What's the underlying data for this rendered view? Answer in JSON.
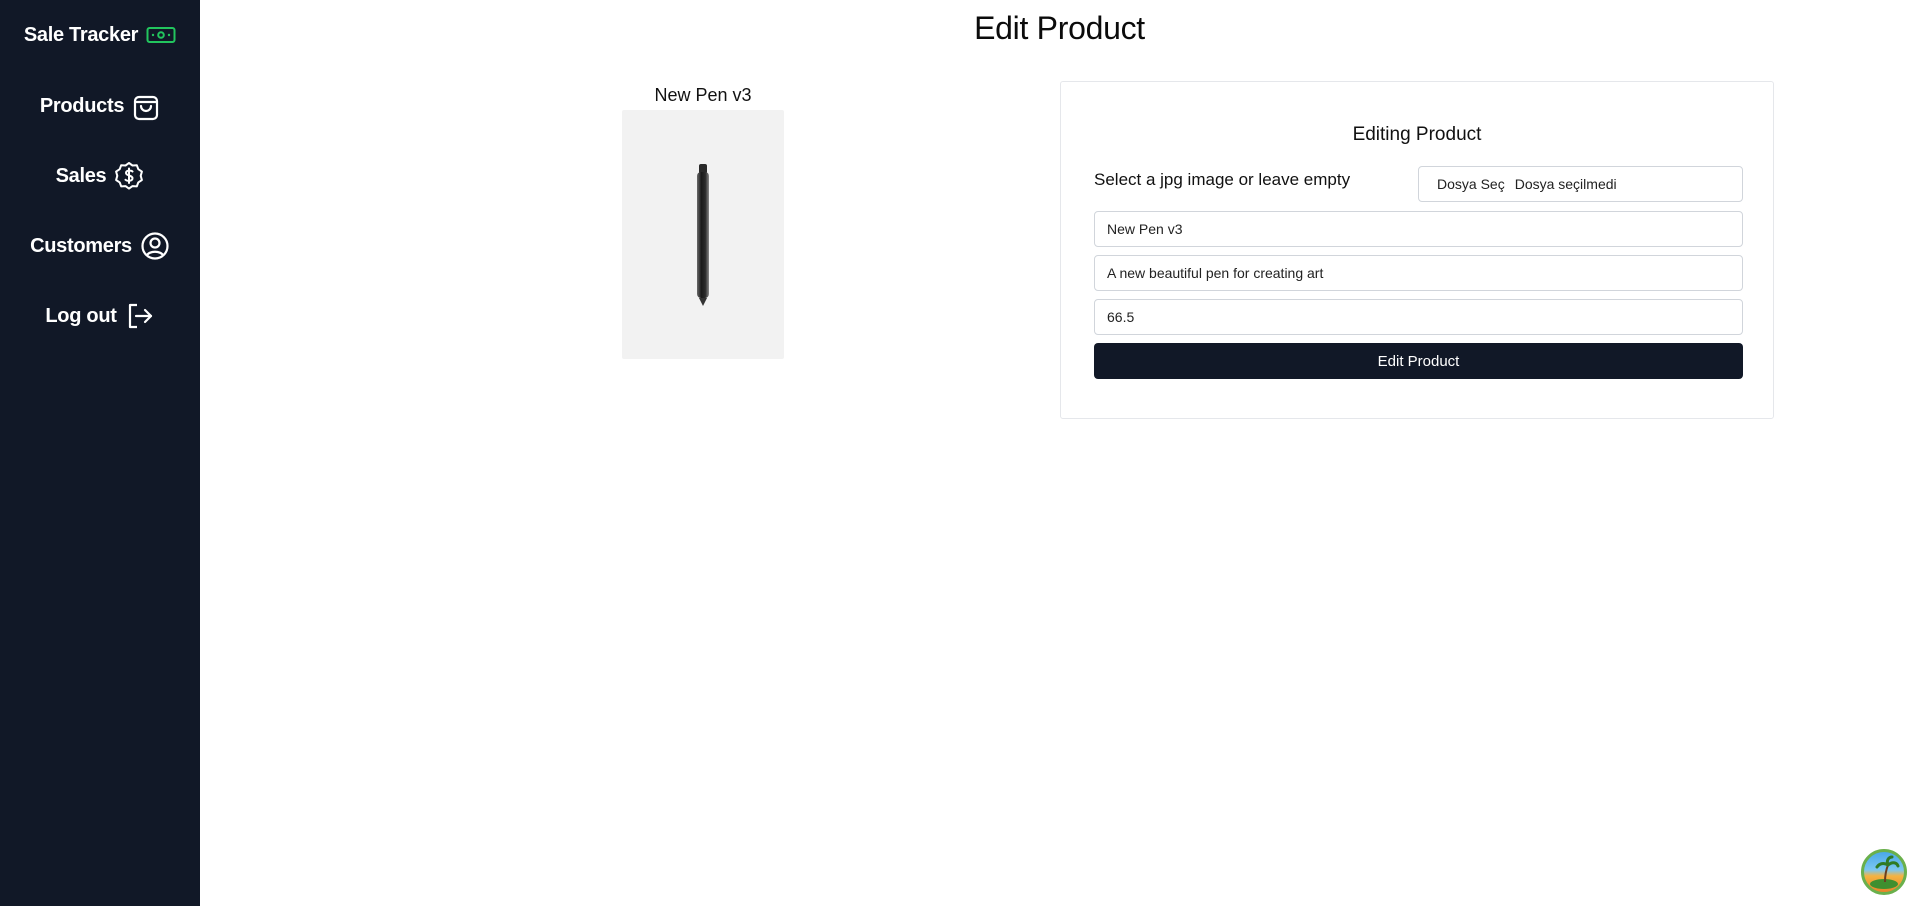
{
  "sidebar": {
    "brand": "Sale Tracker",
    "items": [
      {
        "label": "Products",
        "icon": "shopping-bag-icon"
      },
      {
        "label": "Sales",
        "icon": "dollar-badge-icon"
      },
      {
        "label": "Customers",
        "icon": "user-circle-icon"
      },
      {
        "label": "Log out",
        "icon": "logout-icon"
      }
    ],
    "brand_icon": "banknote-icon",
    "brand_icon_color": "#22c55e",
    "background": "#111827"
  },
  "page": {
    "title": "Edit Product"
  },
  "preview": {
    "name": "New Pen v3",
    "image": "pen-image"
  },
  "form": {
    "title": "Editing Product",
    "file_label": "Select a jpg image or leave empty",
    "file_button": "Dosya Seç",
    "file_status": "Dosya seçilmedi",
    "name_value": "New Pen v3",
    "description_value": "A new beautiful pen for creating art",
    "price_value": "66.5",
    "submit_label": "Edit Product",
    "button_color": "#111827"
  }
}
